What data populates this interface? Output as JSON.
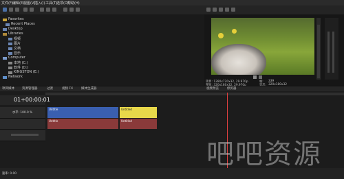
{
  "menu": [
    "文件(F)",
    "编辑(E)",
    "视图(V)",
    "插入(I)",
    "工具(T)",
    "选项(O)",
    "帮助(H)"
  ],
  "explorer": {
    "items": [
      {
        "label": "Favorites"
      },
      {
        "label": "Recent Places"
      },
      {
        "label": "Desktop"
      },
      {
        "label": "Libraries"
      },
      {
        "label": "视频"
      },
      {
        "label": "图片"
      },
      {
        "label": "文档"
      },
      {
        "label": "音乐"
      },
      {
        "label": "Computer"
      },
      {
        "label": "本地 (C:)"
      },
      {
        "label": "软件 (D:)"
      },
      {
        "label": "KINGSTON (E:)"
      },
      {
        "label": "Network"
      }
    ]
  },
  "preview": {
    "info_project": "项目: 1280x720x32, 29.970p",
    "info_preview": "预览: 320x180x32, 29.970p",
    "frame_label": "帧:",
    "frame_value": "339",
    "display_label": "显示:",
    "display_value": "320x180x32"
  },
  "tabs": [
    "项目媒体",
    "资源管理器",
    "过渡",
    "视频 FX",
    "媒体生成器"
  ],
  "preview_tabs": [
    "视频预览",
    "修剪器"
  ],
  "timecode": "01+00:00:01",
  "rate": "1.00",
  "track1": {
    "level_label": "水平: 100.0 %"
  },
  "clips": {
    "video1": "Untitle",
    "video2": "Untitled",
    "audio1": "Untitle",
    "audio2": "Untitled"
  },
  "bottom": {
    "rate_label": "速率: 0.00"
  },
  "watermark": "吧吧资源",
  "colors": {
    "accent": "#e8d84a",
    "video_clip": "#3a5fb0",
    "audio_clip": "#8a3a3a",
    "playhead": "#e04040"
  }
}
